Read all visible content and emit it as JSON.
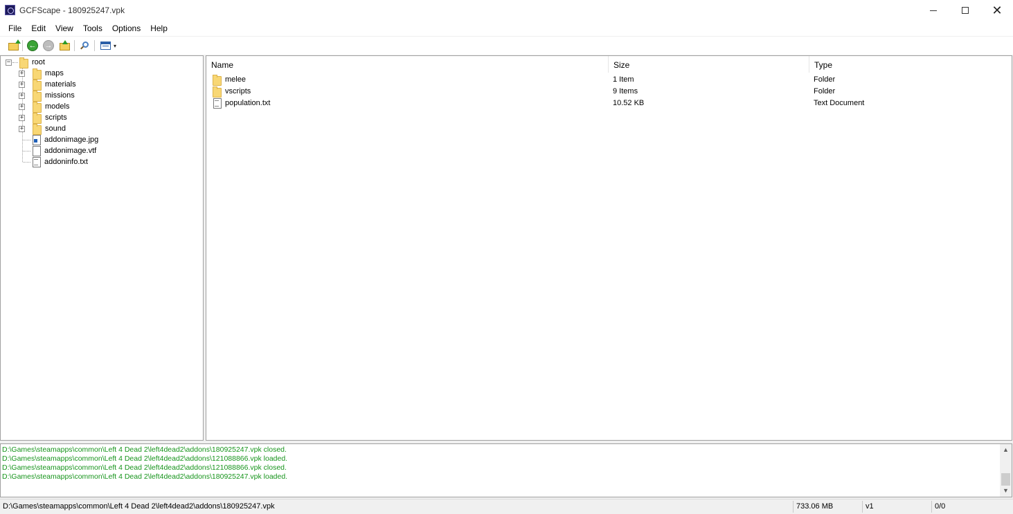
{
  "window": {
    "title": "GCFScape - 180925247.vpk",
    "minimize_glyph": "—",
    "maximize_glyph": "☐",
    "close_glyph": "✕"
  },
  "menu": [
    "File",
    "Edit",
    "View",
    "Tools",
    "Options",
    "Help"
  ],
  "toolbar": {
    "icons": [
      "open-icon",
      "back-icon",
      "forward-icon",
      "up-folder-icon",
      "find-icon",
      "view-mode-icon",
      "dropdown-arrow-icon"
    ],
    "back_glyph": "←",
    "forward_glyph": "→",
    "dropdown_glyph": "▾"
  },
  "tree": {
    "root": "root",
    "expand_glyph": "+",
    "collapse_glyph": "−",
    "folders": [
      "maps",
      "materials",
      "missions",
      "models",
      "scripts",
      "sound"
    ],
    "files": [
      {
        "name": "addonimage.jpg",
        "icon": "image-file-icon"
      },
      {
        "name": "addonimage.vtf",
        "icon": "file-icon"
      },
      {
        "name": "addoninfo.txt",
        "icon": "text-file-icon"
      }
    ]
  },
  "list": {
    "columns": [
      "Name",
      "Size",
      "Type"
    ],
    "rows": [
      {
        "name": "melee",
        "size": "1 Item",
        "type": "Folder",
        "icon": "folder-icon"
      },
      {
        "name": "vscripts",
        "size": "9 Items",
        "type": "Folder",
        "icon": "folder-icon"
      },
      {
        "name": "population.txt",
        "size": "10.52 KB",
        "type": "Text Document",
        "icon": "text-file-icon"
      }
    ]
  },
  "log": {
    "color": "#16941b",
    "lines": [
      "D:\\Games\\steamapps\\common\\Left 4 Dead 2\\left4dead2\\addons\\180925247.vpk closed.",
      "D:\\Games\\steamapps\\common\\Left 4 Dead 2\\left4dead2\\addons\\121088866.vpk loaded.",
      "D:\\Games\\steamapps\\common\\Left 4 Dead 2\\left4dead2\\addons\\121088866.vpk closed.",
      "D:\\Games\\steamapps\\common\\Left 4 Dead 2\\left4dead2\\addons\\180925247.vpk loaded."
    ],
    "scroll_up_glyph": "▲",
    "scroll_down_glyph": "▼"
  },
  "status": {
    "path": "D:\\Games\\steamapps\\common\\Left 4 Dead 2\\left4dead2\\addons\\180925247.vpk",
    "size": "733.06 MB",
    "version": "v1",
    "fragmentation": "0/0"
  }
}
